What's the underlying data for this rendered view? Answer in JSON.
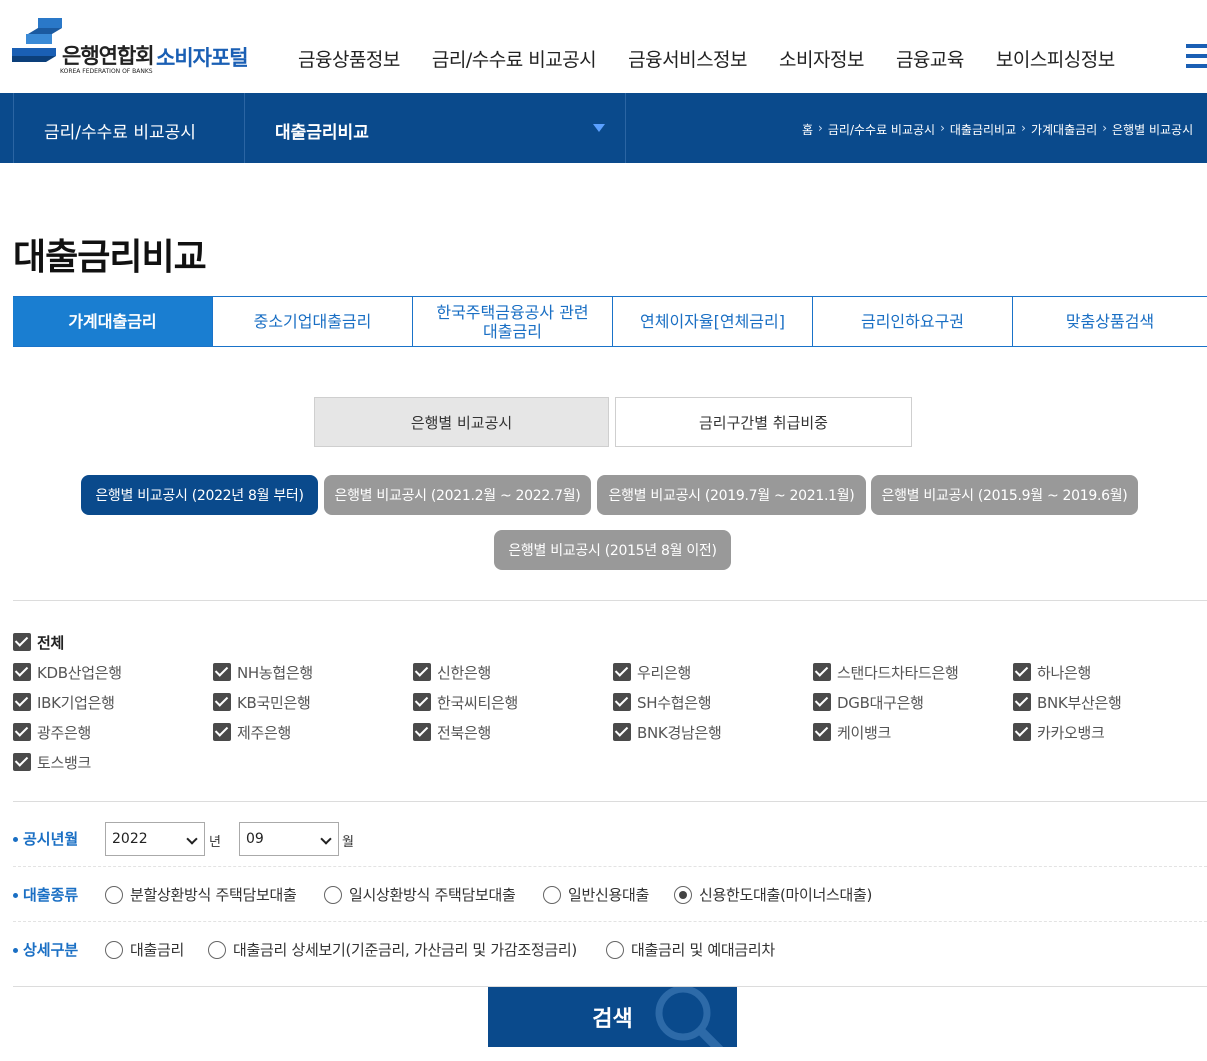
{
  "header": {
    "logo_ko": "은행연합회",
    "logo_en": "KOREA FEDERATION OF BANKS",
    "logo_portal": "소비자포털",
    "nav": [
      "금융상품정보",
      "금리/수수료 비교공시",
      "금융서비스정보",
      "소비자정보",
      "금융교육",
      "보이스피싱정보"
    ]
  },
  "subbar": {
    "section": "금리/수수료 비교공시",
    "current": "대출금리비교",
    "breadcrumb": [
      "홈",
      "금리/수수료 비교공시",
      "대출금리비교",
      "가계대출금리",
      "은행별 비교공시"
    ]
  },
  "page_title": "대출금리비교",
  "tabs": [
    {
      "label": "가계대출금리"
    },
    {
      "label": "중소기업대출금리"
    },
    {
      "label": "한국주택금융공사 관련\n대출금리"
    },
    {
      "label": "연체이자율[연체금리]"
    },
    {
      "label": "금리인하요구권"
    },
    {
      "label": "맞춤상품검색"
    }
  ],
  "toggles": [
    "은행별 비교공시",
    "금리구간별 취급비중"
  ],
  "periods": [
    "은행별 비교공시 (2022년 8월 부터)",
    "은행별 비교공시 (2021.2월 ~ 2022.7월)",
    "은행별 비교공시 (2019.7월 ~ 2021.1월)",
    "은행별 비교공시 (2015.9월 ~ 2019.6월)",
    "은행별 비교공시 (2015년 8월 이전)"
  ],
  "banks": {
    "all_label": "전체",
    "items": [
      "KDB산업은행",
      "NH농협은행",
      "신한은행",
      "우리은행",
      "스탠다드차타드은행",
      "하나은행",
      "IBK기업은행",
      "KB국민은행",
      "한국씨티은행",
      "SH수협은행",
      "DGB대구은행",
      "BNK부산은행",
      "광주은행",
      "제주은행",
      "전북은행",
      "BNK경남은행",
      "케이뱅크",
      "카카오뱅크",
      "토스뱅크"
    ]
  },
  "form": {
    "period_label": "공시년월",
    "year": "2022",
    "year_unit": "년",
    "month": "09",
    "month_unit": "월",
    "loan_type_label": "대출종류",
    "loan_types": [
      "분할상환방식 주택담보대출",
      "일시상환방식 주택담보대출",
      "일반신용대출",
      "신용한도대출(마이너스대출)"
    ],
    "loan_type_selected": "신용한도대출(마이너스대출)",
    "detail_label": "상세구분",
    "details": [
      "대출금리",
      "대출금리 상세보기(기준금리, 가산금리 및 가감조정금리)",
      "대출금리 및 예대금리차"
    ]
  },
  "search_label": "검색",
  "colors": {
    "primary": "#0a4a8c",
    "tab_active": "#1a7ed1",
    "accent": "#1a6fc4",
    "pill_inactive": "#999999"
  }
}
